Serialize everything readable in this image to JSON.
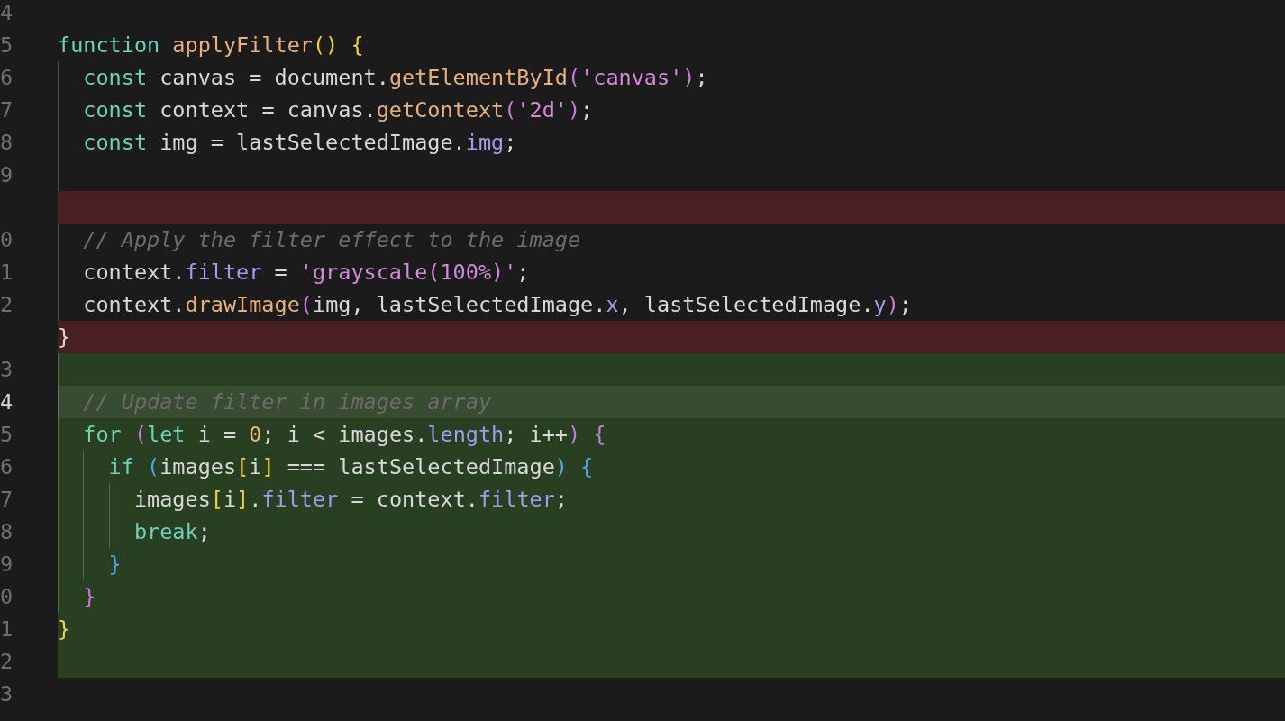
{
  "editor": {
    "rows": [
      {
        "number": "4",
        "deleted": false,
        "added": false,
        "current": false,
        "in_block": false
      },
      {
        "number": "5",
        "deleted": false,
        "added": false,
        "current": false,
        "in_block": false,
        "tokens": [
          {
            "t": "function",
            "kind": "kw"
          },
          {
            "t": " applyFilter",
            "kind": "fn"
          },
          {
            "t": "()",
            "kind": "b1"
          },
          {
            "t": " {",
            "kind": "b1"
          }
        ]
      },
      {
        "number": "6",
        "deleted": false,
        "added": false,
        "current": false,
        "in_block": false,
        "tokens": [
          {
            "t": "  const",
            "kind": "kw"
          },
          {
            "t": " canvas = document.",
            "kind": "plain"
          },
          {
            "t": "getElementById",
            "kind": "fn"
          },
          {
            "t": "(",
            "kind": "b2"
          },
          {
            "t": "'canvas'",
            "kind": "str"
          },
          {
            "t": ")",
            "kind": "b2"
          },
          {
            "t": ";",
            "kind": "plain"
          }
        ]
      },
      {
        "number": "7",
        "deleted": false,
        "added": false,
        "current": false,
        "in_block": false,
        "tokens": [
          {
            "t": "  const",
            "kind": "kw"
          },
          {
            "t": " context = canvas.",
            "kind": "plain"
          },
          {
            "t": "getContext",
            "kind": "fn"
          },
          {
            "t": "(",
            "kind": "b2"
          },
          {
            "t": "'2d'",
            "kind": "str"
          },
          {
            "t": ")",
            "kind": "b2"
          },
          {
            "t": ";",
            "kind": "plain"
          }
        ]
      },
      {
        "number": "8",
        "deleted": false,
        "added": false,
        "current": false,
        "in_block": false,
        "tokens": [
          {
            "t": "  const",
            "kind": "kw"
          },
          {
            "t": " img = lastSelectedImage.",
            "kind": "plain"
          },
          {
            "t": "img",
            "kind": "prop"
          },
          {
            "t": ";",
            "kind": "plain"
          }
        ]
      },
      {
        "number": "9",
        "deleted": false,
        "added": false,
        "current": false,
        "in_block": true
      },
      {
        "deleted": true,
        "added": false,
        "current": false,
        "in_block": false
      },
      {
        "number": "0",
        "deleted": false,
        "added": false,
        "current": false,
        "in_block": false,
        "tokens": [
          {
            "t": "  // Apply the filter effect to the image",
            "kind": "comment"
          }
        ]
      },
      {
        "number": "1",
        "deleted": false,
        "added": false,
        "current": false,
        "in_block": false,
        "tokens": [
          {
            "t": "  context.",
            "kind": "plain"
          },
          {
            "t": "filter",
            "kind": "prop"
          },
          {
            "t": " = ",
            "kind": "plain"
          },
          {
            "t": "'grayscale(100%)'",
            "kind": "str"
          },
          {
            "t": ";",
            "kind": "plain"
          }
        ]
      },
      {
        "number": "2",
        "deleted": false,
        "added": false,
        "current": false,
        "in_block": false,
        "tokens": [
          {
            "t": "  context.",
            "kind": "plain"
          },
          {
            "t": "drawImage",
            "kind": "fn"
          },
          {
            "t": "(",
            "kind": "b2"
          },
          {
            "t": "img, lastSelectedImage.",
            "kind": "plain"
          },
          {
            "t": "x",
            "kind": "prop"
          },
          {
            "t": ", lastSelectedImage.",
            "kind": "plain"
          },
          {
            "t": "y",
            "kind": "prop"
          },
          {
            "t": ")",
            "kind": "b2"
          },
          {
            "t": ";",
            "kind": "plain"
          }
        ]
      },
      {
        "deleted": true,
        "added": false,
        "current": false,
        "in_block": false,
        "tokens": [
          {
            "t": "}",
            "kind": "plain"
          }
        ]
      },
      {
        "number": "3",
        "deleted": false,
        "added": true,
        "current": false,
        "in_block": true
      },
      {
        "number": "4",
        "deleted": false,
        "added": true,
        "current": true,
        "in_block": false,
        "tokens": [
          {
            "t": "  // Update filter in images array",
            "kind": "comment"
          }
        ]
      },
      {
        "number": "5",
        "deleted": false,
        "added": true,
        "current": false,
        "in_block": false,
        "tokens": [
          {
            "t": "  for",
            "kind": "kw"
          },
          {
            "t": " (",
            "kind": "b2"
          },
          {
            "t": "let",
            "kind": "kw"
          },
          {
            "t": " i = ",
            "kind": "plain"
          },
          {
            "t": "0",
            "kind": "num"
          },
          {
            "t": "; i < images.",
            "kind": "plain"
          },
          {
            "t": "length",
            "kind": "prop"
          },
          {
            "t": "; i++",
            "kind": "plain"
          },
          {
            "t": ")",
            "kind": "b2"
          },
          {
            "t": " {",
            "kind": "b2"
          }
        ]
      },
      {
        "number": "6",
        "deleted": false,
        "added": true,
        "current": false,
        "in_block": false,
        "tokens": [
          {
            "t": "    if",
            "kind": "kw"
          },
          {
            "t": " (",
            "kind": "b3"
          },
          {
            "t": "images",
            "kind": "plain"
          },
          {
            "t": "[",
            "kind": "b1"
          },
          {
            "t": "i",
            "kind": "plain"
          },
          {
            "t": "]",
            "kind": "b1"
          },
          {
            "t": " === lastSelectedImage",
            "kind": "plain"
          },
          {
            "t": ")",
            "kind": "b3"
          },
          {
            "t": " {",
            "kind": "b3"
          }
        ]
      },
      {
        "number": "7",
        "deleted": false,
        "added": true,
        "current": false,
        "in_block": false,
        "tokens": [
          {
            "t": "      images",
            "kind": "plain"
          },
          {
            "t": "[",
            "kind": "b1"
          },
          {
            "t": "i",
            "kind": "plain"
          },
          {
            "t": "]",
            "kind": "b1"
          },
          {
            "t": ".",
            "kind": "plain"
          },
          {
            "t": "filter",
            "kind": "prop"
          },
          {
            "t": " = context.",
            "kind": "plain"
          },
          {
            "t": "filter",
            "kind": "prop"
          },
          {
            "t": ";",
            "kind": "plain"
          }
        ]
      },
      {
        "number": "8",
        "deleted": false,
        "added": true,
        "current": false,
        "in_block": false,
        "tokens": [
          {
            "t": "      break",
            "kind": "kw"
          },
          {
            "t": ";",
            "kind": "plain"
          }
        ]
      },
      {
        "number": "9",
        "deleted": false,
        "added": true,
        "current": false,
        "in_block": false,
        "tokens": [
          {
            "t": "    }",
            "kind": "b3"
          }
        ]
      },
      {
        "number": "0",
        "deleted": false,
        "added": true,
        "current": false,
        "in_block": false,
        "tokens": [
          {
            "t": "  }",
            "kind": "b2"
          }
        ]
      },
      {
        "number": "1",
        "deleted": false,
        "added": true,
        "current": false,
        "in_block": false,
        "tokens": [
          {
            "t": "}",
            "kind": "b1"
          }
        ]
      },
      {
        "number": "2",
        "deleted": false,
        "added": true,
        "current": false,
        "in_block": false
      },
      {
        "number": "3",
        "deleted": false,
        "added": false,
        "current": false,
        "in_block": false
      }
    ]
  }
}
